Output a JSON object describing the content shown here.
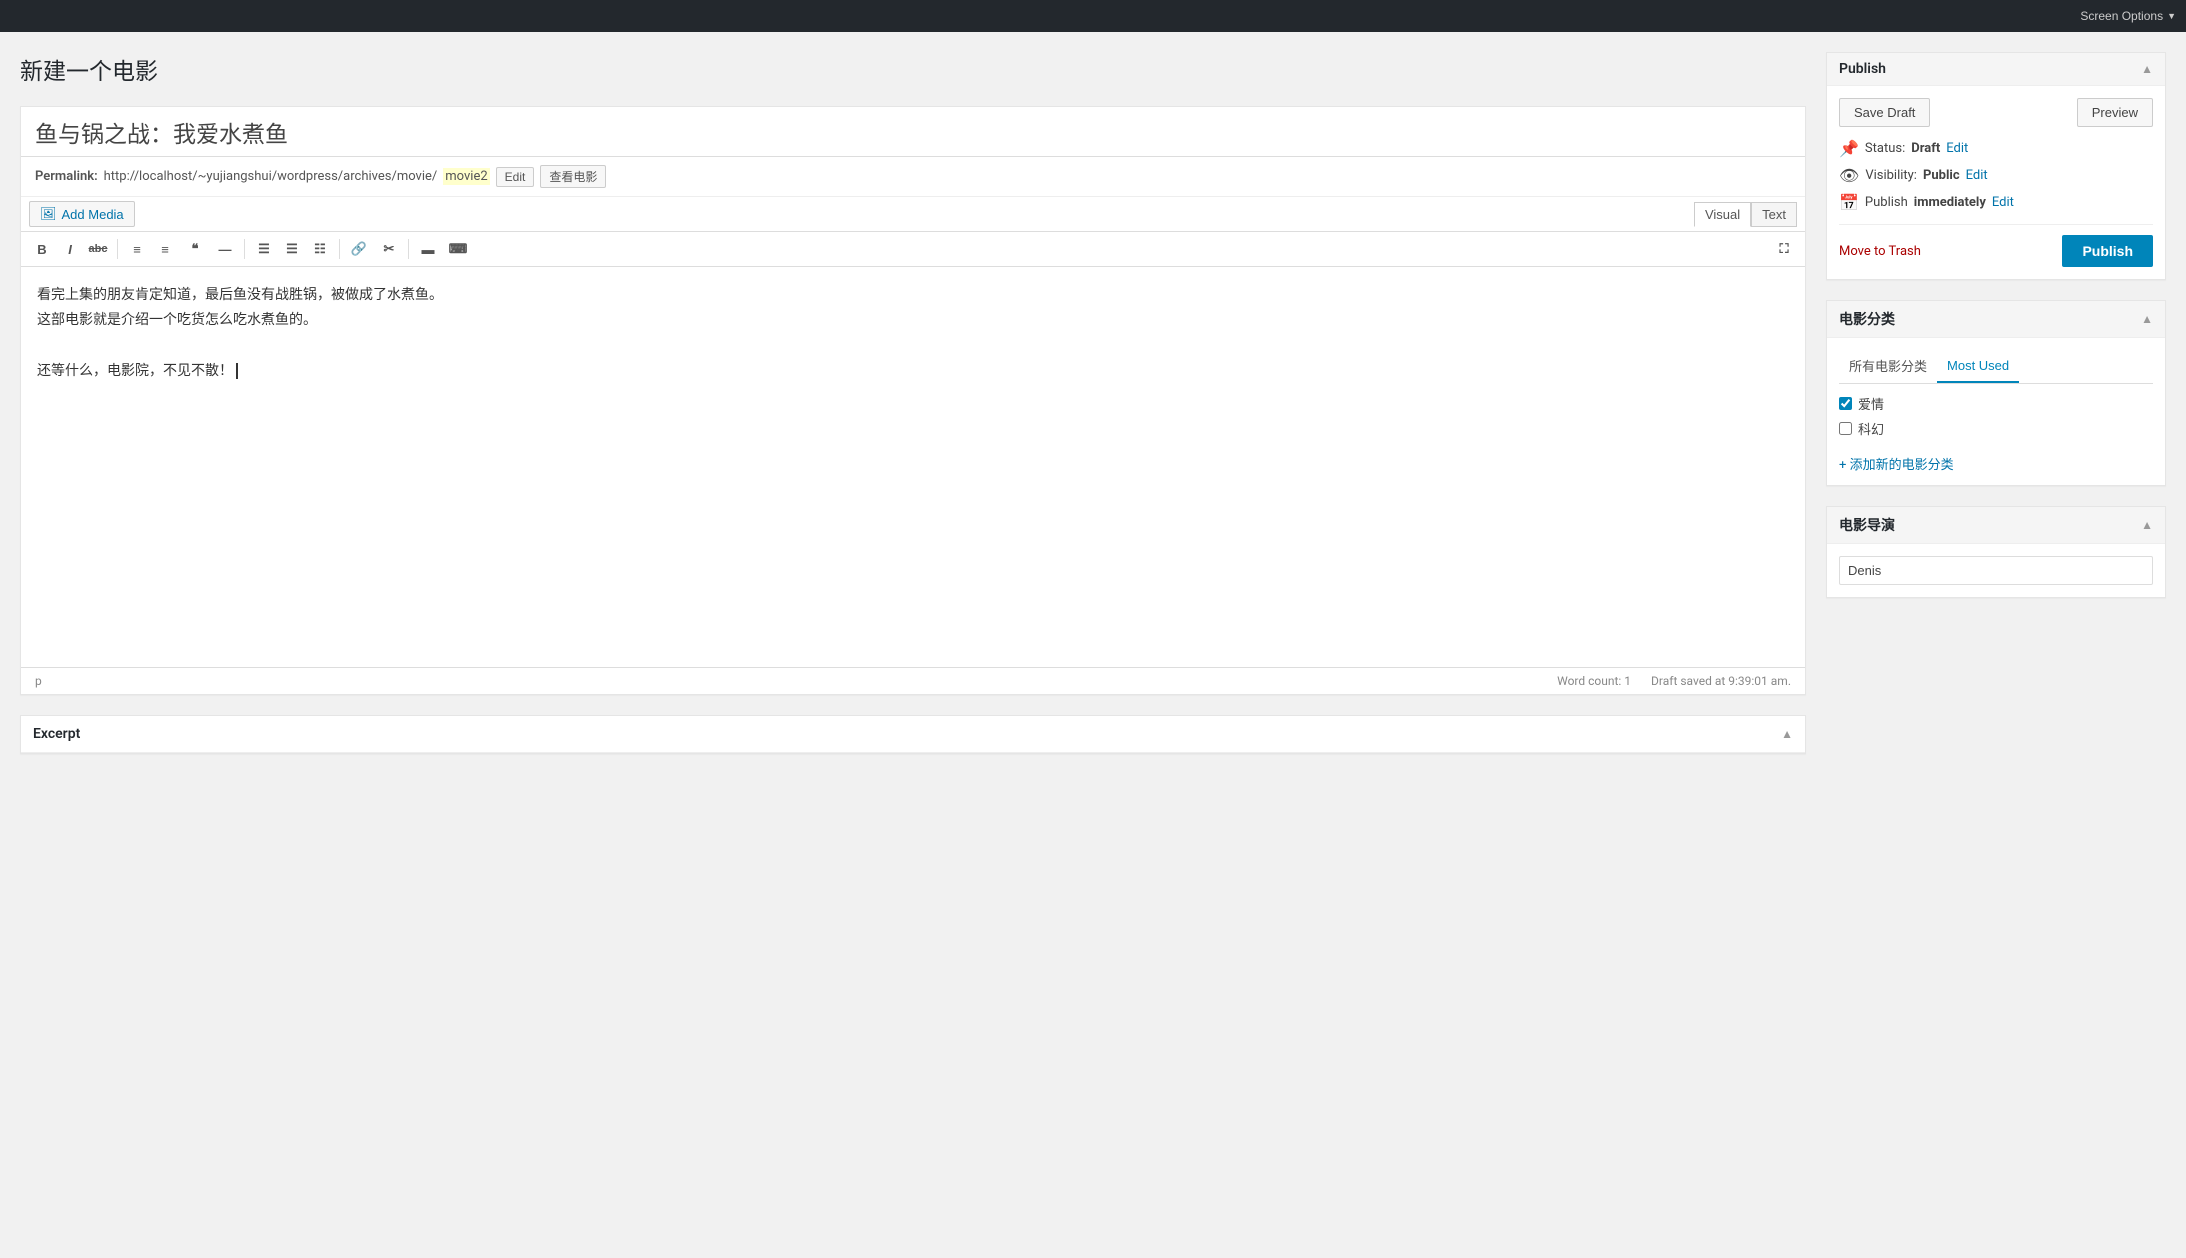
{
  "topbar": {
    "screen_options": "Screen Options"
  },
  "page": {
    "title": "新建一个电影"
  },
  "editor": {
    "post_title": "鱼与锅之战：我爱水煮鱼",
    "permalink_label": "Permalink:",
    "permalink_url": "http://localhost/~yujiangshui/wordpress/archives/movie/",
    "permalink_slug": "movie2",
    "edit_btn": "Edit",
    "view_btn": "查看电影",
    "add_media_label": "Add Media",
    "tab_visual": "Visual",
    "tab_text": "Text",
    "content_line1": "看完上集的朋友肯定知道，最后鱼没有战胜锅，被做成了水煮鱼。",
    "content_line2": "这部电影就是介绍一个吃货怎么吃水煮鱼的。",
    "content_line3": "还等什么，电影院，不见不散！",
    "footer_tag": "p",
    "word_count_label": "Word count: 1",
    "draft_saved": "Draft saved at 9:39:01 am."
  },
  "excerpt": {
    "label": "Excerpt"
  },
  "publish_box": {
    "title": "Publish",
    "save_draft": "Save Draft",
    "preview": "Preview",
    "status_label": "Status:",
    "status_value": "Draft",
    "status_edit": "Edit",
    "visibility_label": "Visibility:",
    "visibility_value": "Public",
    "visibility_edit": "Edit",
    "publish_label": "Publish",
    "publish_timing": "immediately",
    "publish_timing_edit": "Edit",
    "move_to_trash": "Move to Trash",
    "publish_btn": "Publish"
  },
  "categories_box": {
    "title": "电影分类",
    "tab_all": "所有电影分类",
    "tab_most_used": "Most Used",
    "categories": [
      {
        "name": "爱情",
        "checked": true
      },
      {
        "name": "科幻",
        "checked": false
      }
    ],
    "add_new_link": "+ 添加新的电影分类"
  },
  "director_box": {
    "title": "电影导演",
    "value": "Denis"
  },
  "toolbar": {
    "bold": "B",
    "italic": "I",
    "strikethrough": "abc",
    "ul": "≡",
    "ol": "≡",
    "blockquote": "❝",
    "hr": "—",
    "align_left": "◧",
    "align_center": "☰",
    "align_right": "☷",
    "link": "🔗",
    "unlink": "✂",
    "insert_more": "▬",
    "kbd": "⌨",
    "fullscreen": "⛶"
  }
}
